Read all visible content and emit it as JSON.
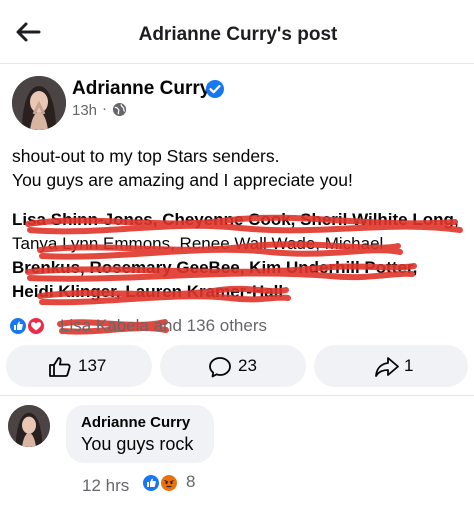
{
  "header": {
    "title": "Adrianne Curry's post",
    "back_icon": "back-arrow-icon"
  },
  "post": {
    "author": "Adrianne Curry",
    "time": "13h",
    "separator": "·",
    "privacy_icon": "globe-icon",
    "text_line1": "shout-out to my top Stars senders.",
    "text_line2": "You guys are amazing and I appreciate you!",
    "names_line1": "Lisa Shinn-Jones, Cheyenne Cook, Sheril Wilhite Long,",
    "names_line2": "Tanya Lynn Emmons, Renee Wall Wade, Michael",
    "names_line3": "Brenkus, Rosemary GeeBee, Kim Underhill Potter,",
    "names_line4": "Heidi Klinger, Lauren Kramer-Hall",
    "reaction_prefix": "Lisa Kabela",
    "reaction_suffix": " and 136 others",
    "reaction_icons": [
      "like-icon",
      "love-icon"
    ],
    "colors": {
      "like": "#1877f2",
      "love": "#f02849",
      "verified": "#1877f2",
      "scribble": "#e0352b"
    }
  },
  "actions": {
    "like_count": "137",
    "comment_count": "23",
    "share_count": "1"
  },
  "comment": {
    "author": "Adrianne Curry",
    "text": "You guys rock",
    "time": "12 hrs",
    "reaction_count": "8",
    "reaction_icons": [
      "like-icon",
      "angry-icon"
    ]
  }
}
